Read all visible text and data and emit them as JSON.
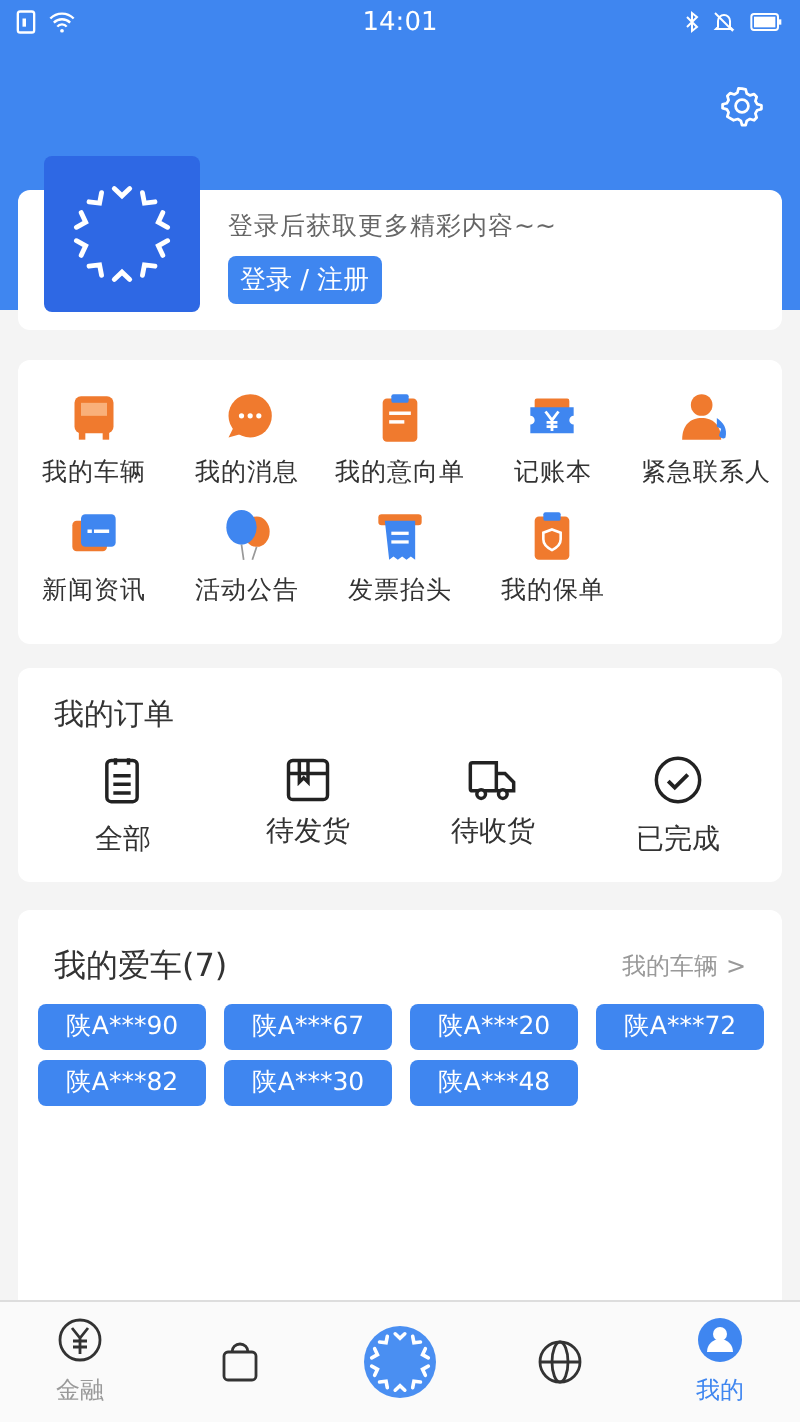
{
  "status_bar": {
    "time": "14:01"
  },
  "profile": {
    "prompt": "登录后获取更多精彩内容~~",
    "login_button": "登录 / 注册"
  },
  "services": [
    {
      "label": "我的车辆"
    },
    {
      "label": "我的消息"
    },
    {
      "label": "我的意向单"
    },
    {
      "label": "记账本"
    },
    {
      "label": "紧急联系人"
    },
    {
      "label": "新闻资讯"
    },
    {
      "label": "活动公告"
    },
    {
      "label": "发票抬头"
    },
    {
      "label": "我的保单"
    }
  ],
  "orders": {
    "title": "我的订单",
    "items": [
      {
        "label": "全部"
      },
      {
        "label": "待发货"
      },
      {
        "label": "待收货"
      },
      {
        "label": "已完成"
      }
    ]
  },
  "cars": {
    "title": "我的爱车(7)",
    "link": "我的车辆 >",
    "plates": [
      "陕A***90",
      "陕A***67",
      "陕A***20",
      "陕A***72",
      "陕A***82",
      "陕A***30",
      "陕A***48"
    ]
  },
  "bottom_nav": [
    {
      "label": "金融",
      "selected": false
    },
    {
      "selected": false
    },
    {
      "selected": false
    },
    {
      "selected": false
    },
    {
      "label": "我的",
      "selected": true
    }
  ]
}
